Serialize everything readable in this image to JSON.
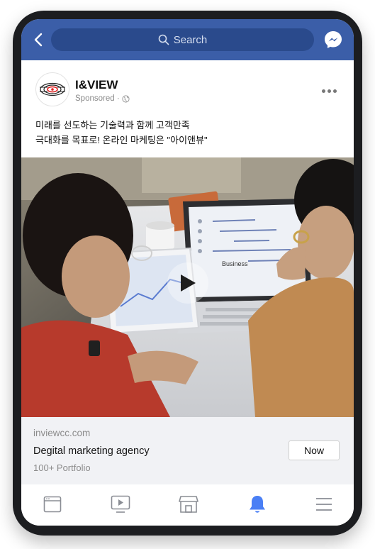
{
  "topbar": {
    "search_placeholder": "Search",
    "accent_color": "#3b5ea8",
    "icons": [
      "back-arrow-icon",
      "search-icon",
      "messenger-icon"
    ]
  },
  "post": {
    "page_name": "I&VIEW",
    "sponsored_label": "Sponsored ·",
    "sponsored_icon": "globe-icon",
    "caption_lines": [
      "미래를 선도하는 기술력과 함께 고객만족",
      "극대화를 목표로! 온라인 마케팅은 \"아이앤뷰\""
    ],
    "media": {
      "type": "video",
      "laptop_screen_text": "Business",
      "play_icon": "play-icon"
    }
  },
  "link_preview": {
    "domain": "inviewcc.com",
    "headline": "Degital marketing agency",
    "subline": "100+ Portfolio",
    "cta_label": "Now"
  },
  "bottom_nav": {
    "active_color": "#4a7ff5",
    "items": [
      {
        "name": "news-feed-icon",
        "active": false
      },
      {
        "name": "watch-video-icon",
        "active": false
      },
      {
        "name": "marketplace-icon",
        "active": false
      },
      {
        "name": "notifications-bell-icon",
        "active": true
      },
      {
        "name": "menu-icon",
        "active": false
      }
    ]
  }
}
